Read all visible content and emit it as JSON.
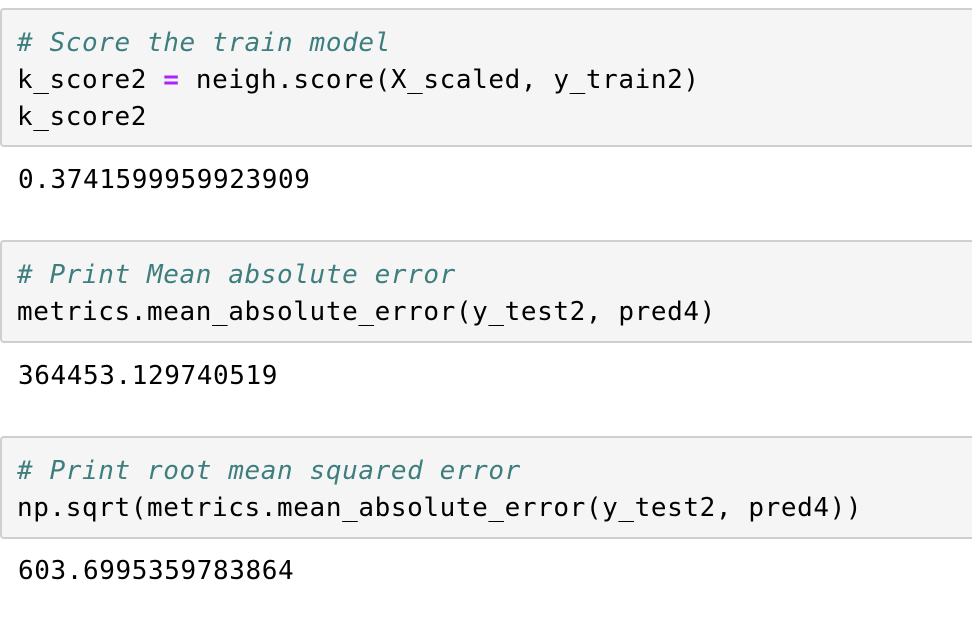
{
  "cells": [
    {
      "comment": "# Score the train model",
      "code_lines": [
        {
          "lhs": "k_score2",
          "op": "=",
          "rhs": "neigh.score(X_scaled, y_train2)"
        },
        {
          "text": "k_score2"
        }
      ],
      "output": "0.3741599959923909"
    },
    {
      "comment": "# Print Mean absolute error",
      "code_lines": [
        {
          "text": "metrics.mean_absolute_error(y_test2, pred4)"
        }
      ],
      "output": "364453.129740519"
    },
    {
      "comment": "# Print root mean squared error",
      "code_lines": [
        {
          "text": "np.sqrt(metrics.mean_absolute_error(y_test2, pred4))"
        }
      ],
      "output": "603.6995359783864"
    }
  ],
  "colors": {
    "comment": "#3e7e7e",
    "operator": "#aa22ff",
    "input_background": "#f5f5f5",
    "input_border": "#cfcfcf"
  }
}
